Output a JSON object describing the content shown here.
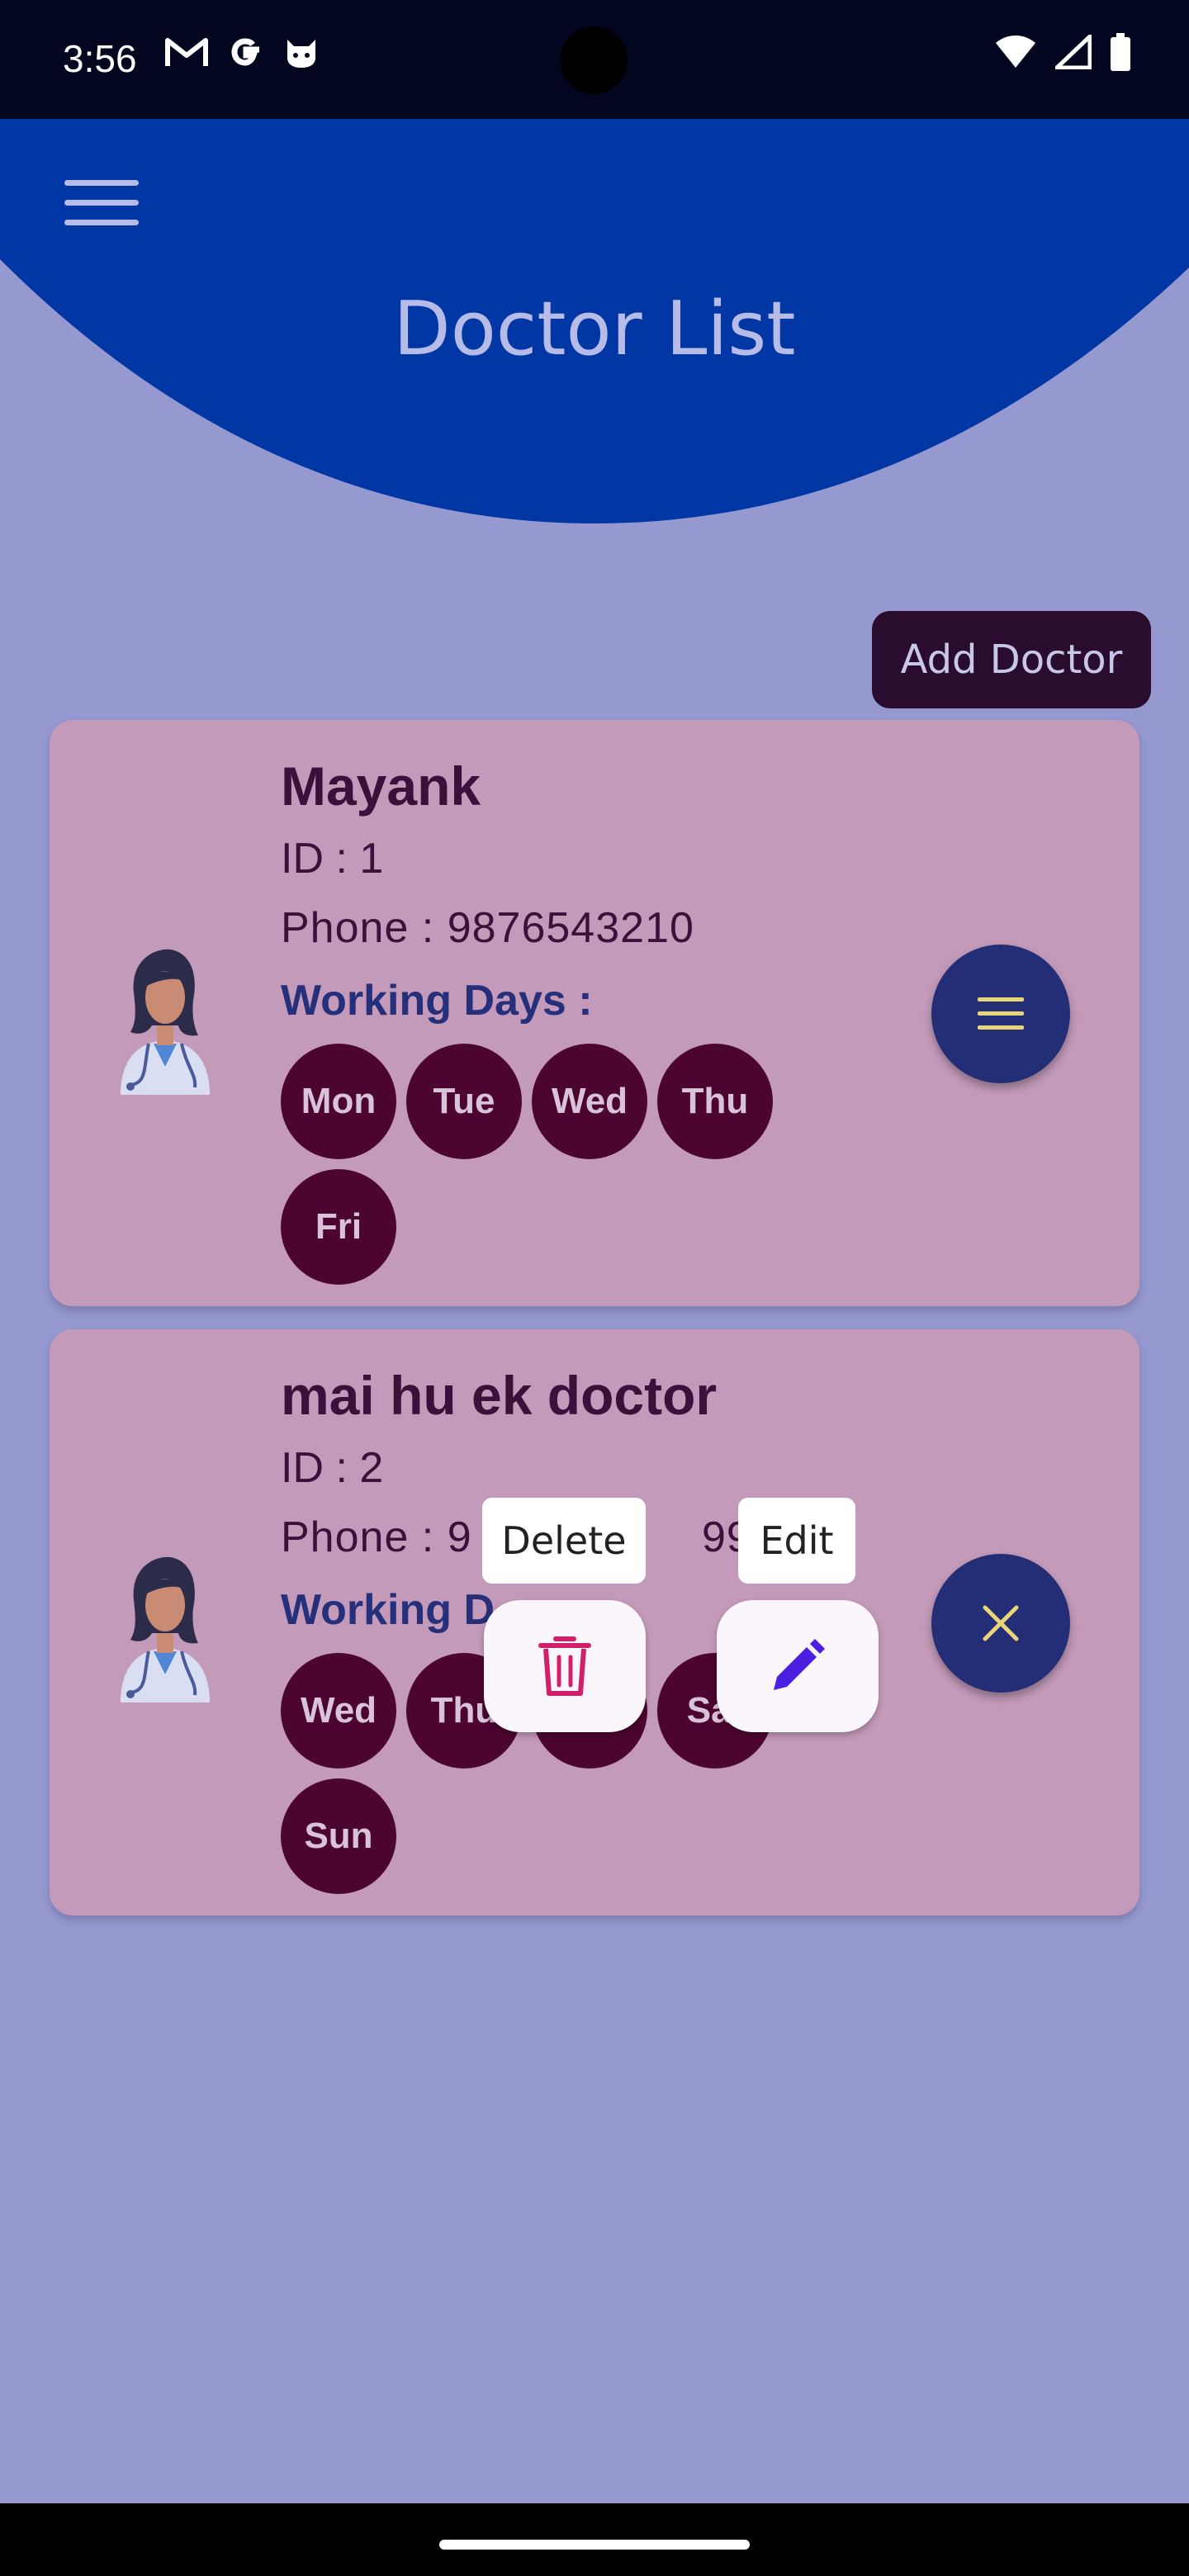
{
  "status_bar": {
    "time": "3:56",
    "left_icons": [
      "gmail-icon",
      "google-icon",
      "cat-icon"
    ],
    "right_icons": [
      "wifi-icon",
      "signal-icon",
      "battery-icon"
    ]
  },
  "header": {
    "title": "Doctor List",
    "menu_icon": "hamburger-menu-icon",
    "color": "#0037a4"
  },
  "actions": {
    "add_doctor_label": "Add Doctor"
  },
  "doctors": [
    {
      "name": "Mayank",
      "id_text": "ID : 1",
      "phone_text": "Phone : 9876543210",
      "working_days_label": "Working Days :",
      "days": [
        "Mon",
        "Tue",
        "Wed",
        "Thu",
        "Fri"
      ],
      "fab_icon": "menu-icon"
    },
    {
      "name": "mai hu ek doctor",
      "id_text": "ID : 2",
      "phone_text": "Phone : 9",
      "phone_suffix": "999",
      "working_days_label": "Working D",
      "days": [
        "Wed",
        "Thu",
        "",
        "Sat",
        "Sun"
      ],
      "fab_icon": "close-icon"
    }
  ],
  "speed_dial": {
    "delete_label": "Delete",
    "edit_label": "Edit",
    "delete_icon": "trash-icon",
    "edit_icon": "pencil-icon"
  },
  "colors": {
    "background": "#9599d0",
    "card": "#c39ab9",
    "day_chip": "#4c0530",
    "fab": "#242e76",
    "add_button": "#2a0d2e"
  }
}
